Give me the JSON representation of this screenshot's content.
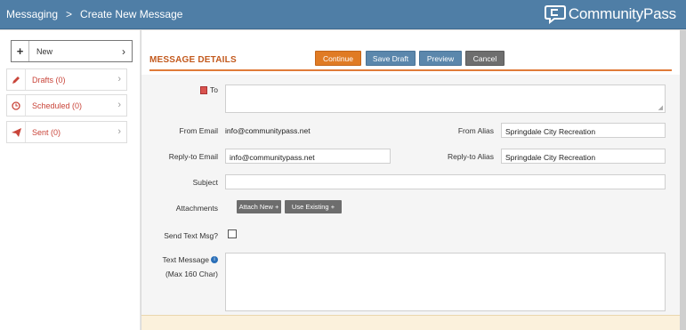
{
  "header": {
    "breadcrumb": [
      "Messaging",
      "Create New Message"
    ],
    "separator": ">",
    "brand": "CommunityPass"
  },
  "sidebar": {
    "new_label": "New",
    "items": [
      {
        "label": "Drafts (0)",
        "icon": "pencil-icon"
      },
      {
        "label": "Scheduled (0)",
        "icon": "clock-icon"
      },
      {
        "label": "Sent (0)",
        "icon": "paper-plane-icon"
      }
    ]
  },
  "main": {
    "section_title": "MESSAGE DETAILS",
    "buttons": {
      "continue": "Continue",
      "save_draft": "Save Draft",
      "preview": "Preview",
      "cancel": "Cancel"
    },
    "form": {
      "to_label": "To",
      "from_email_label": "From Email",
      "from_email_value": "info@communitypass.net",
      "from_alias_label": "From Alias",
      "from_alias_value": "Springdale City Recreation",
      "reply_email_label": "Reply-to Email",
      "reply_email_value": "info@communitypass.net",
      "reply_alias_label": "Reply-to Alias",
      "reply_alias_value": "Springdale City Recreation",
      "subject_label": "Subject",
      "subject_value": "",
      "attachments_label": "Attachments",
      "attach_new": "Attach New +",
      "use_existing": "Use Existing +",
      "send_text_label": "Send Text Msg?",
      "text_message_label": "Text Message",
      "text_message_sub": "(Max 160 Char)",
      "text_message_value": ""
    }
  },
  "colors": {
    "header": "#4f7ea6",
    "accent": "#e07b24",
    "sidebar_text": "#c9453a"
  }
}
